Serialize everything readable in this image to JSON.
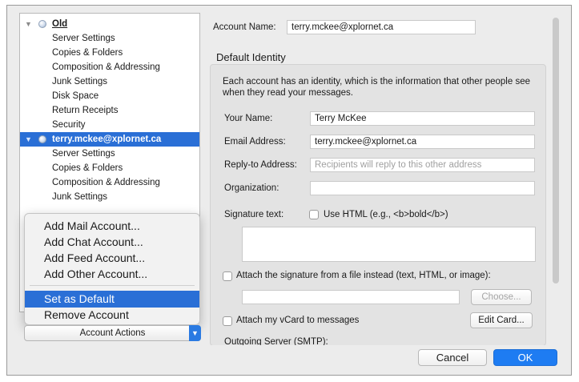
{
  "tree": {
    "account1": {
      "name": "Old",
      "items": [
        "Server Settings",
        "Copies & Folders",
        "Composition & Addressing",
        "Junk Settings",
        "Disk Space",
        "Return Receipts",
        "Security"
      ]
    },
    "account2": {
      "name": "terry.mckee@xplornet.ca",
      "items": [
        "Server Settings",
        "Copies & Folders",
        "Composition & Addressing",
        "Junk Settings"
      ]
    }
  },
  "menu": {
    "items": [
      "Add Mail Account...",
      "Add Chat Account...",
      "Add Feed Account...",
      "Add Other Account..."
    ],
    "set_default": "Set as Default",
    "remove": "Remove Account"
  },
  "account_actions_label": "Account Actions",
  "account_name": {
    "label": "Account Name:",
    "value": "terry.mckee@xplornet.ca"
  },
  "identity": {
    "title": "Default Identity",
    "description": "Each account has an identity, which is the information that other people see when they read your messages.",
    "your_name": {
      "label": "Your Name:",
      "value": "Terry McKee"
    },
    "email": {
      "label": "Email Address:",
      "value": "terry.mckee@xplornet.ca"
    },
    "reply_to": {
      "label": "Reply-to Address:",
      "placeholder": "Recipients will reply to this other address"
    },
    "organization": {
      "label": "Organization:",
      "value": ""
    },
    "signature_label": "Signature text:",
    "use_html": "Use HTML (e.g., <b>bold</b>)",
    "attach_sig": "Attach the signature from a file instead (text, HTML, or image):",
    "choose": "Choose...",
    "attach_vcard": "Attach my vCard to messages",
    "edit_card": "Edit Card...",
    "outgoing_server": "Outgoing Server (SMTP):"
  },
  "buttons": {
    "cancel": "Cancel",
    "ok": "OK"
  },
  "colors": {
    "accent": "#2a6fd6",
    "ok_button": "#1e7cf2"
  }
}
